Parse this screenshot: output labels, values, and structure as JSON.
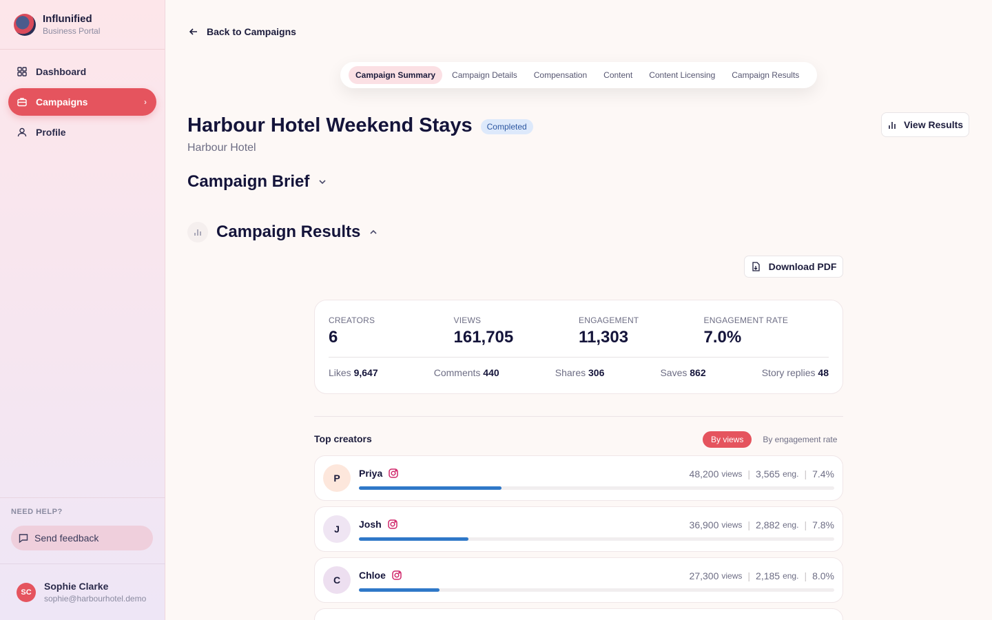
{
  "brand": {
    "name": "Influnified",
    "sub": "Business Portal"
  },
  "nav": [
    {
      "label": "Dashboard",
      "icon": "grid-icon"
    },
    {
      "label": "Campaigns",
      "icon": "briefcase-icon",
      "active": true
    },
    {
      "label": "Profile",
      "icon": "user-icon"
    }
  ],
  "help": {
    "label": "NEED HELP?",
    "feedback": "Send feedback"
  },
  "user": {
    "initials": "SC",
    "name": "Sophie Clarke",
    "email": "sophie@harbourhotel.demo"
  },
  "back_label": "Back to Campaigns",
  "tabs": [
    "Campaign Summary",
    "Campaign Details",
    "Compensation",
    "Content",
    "Content Licensing",
    "Campaign Results"
  ],
  "campaign": {
    "title": "Harbour Hotel Weekend Stays",
    "status": "Completed",
    "brand": "Harbour Hotel"
  },
  "view_results": "View Results",
  "brief_heading": "Campaign Brief",
  "results_heading": "Campaign Results",
  "download_pdf": "Download PDF",
  "stats": [
    {
      "label": "CREATORS",
      "value": "6"
    },
    {
      "label": "VIEWS",
      "value": "161,705"
    },
    {
      "label": "ENGAGEMENT",
      "value": "11,303"
    },
    {
      "label": "ENGAGEMENT RATE",
      "value": "7.0%"
    }
  ],
  "substats": [
    {
      "label": "Likes",
      "value": "9,647"
    },
    {
      "label": "Comments",
      "value": "440"
    },
    {
      "label": "Shares",
      "value": "306"
    },
    {
      "label": "Saves",
      "value": "862"
    },
    {
      "label": "Story replies",
      "value": "48"
    }
  ],
  "top_creators": {
    "heading": "Top creators",
    "toggle_on": "By views",
    "toggle_off": "By engagement rate",
    "items": [
      {
        "initial": "P",
        "name": "Priya",
        "views": "48,200",
        "views_unit": "views",
        "eng": "3,565",
        "eng_unit": "eng.",
        "rate": "7.4%",
        "progress": 0.3,
        "avatar_color": "#fde7dc"
      },
      {
        "initial": "J",
        "name": "Josh",
        "views": "36,900",
        "views_unit": "views",
        "eng": "2,882",
        "eng_unit": "eng.",
        "rate": "7.8%",
        "progress": 0.23,
        "avatar_color": "#efe5f3"
      },
      {
        "initial": "C",
        "name": "Chloe",
        "views": "27,300",
        "views_unit": "views",
        "eng": "2,185",
        "eng_unit": "eng.",
        "rate": "8.0%",
        "progress": 0.17,
        "avatar_color": "#eddff0"
      }
    ]
  },
  "colors": {
    "accent": "#e5545e",
    "bar": "#2f78c8",
    "title": "#14143a"
  }
}
